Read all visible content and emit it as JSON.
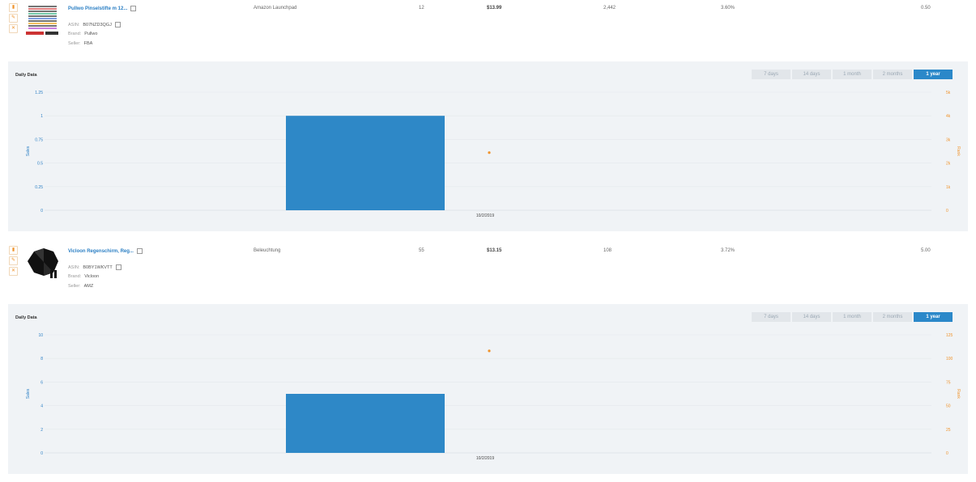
{
  "products": [
    {
      "title": "Pullwo Pinselstifte m 12...",
      "asin_label": "ASIN:",
      "asin": "B07NZD3QGJ",
      "brand_label": "Brand:",
      "brand": "Pullwo",
      "seller_label": "Seller:",
      "seller": "FBA",
      "category": "Amazon Launchpad",
      "col_a": "12",
      "price": "$13.99",
      "col_b": "2,442",
      "col_c": "3.60%",
      "col_d": "0.50",
      "chart": {
        "title": "Daily Data",
        "ranges": [
          "7 days",
          "14 days",
          "1 month",
          "2 months",
          "1 year"
        ],
        "active_range": "1 year",
        "left_axis_label": "Sales",
        "right_axis_label": "Rank",
        "left_ticks": [
          "1.25",
          "1",
          "0.75",
          "0.5",
          "0.25",
          "0"
        ],
        "right_ticks": [
          "5k",
          "4k",
          "3k",
          "2k",
          "1k",
          "0"
        ],
        "x_label": "10/2/2019"
      }
    },
    {
      "title": "Vicloon Regenschirm, Reg...",
      "asin_label": "ASIN:",
      "asin": "B0BY1WKVTT",
      "brand_label": "Brand:",
      "brand": "Vicloon",
      "seller_label": "Seller:",
      "seller": "AMZ",
      "category": "Beleuchtung",
      "col_a": "55",
      "price": "$13.15",
      "col_b": "108",
      "col_c": "3.72%",
      "col_d": "5.00",
      "chart": {
        "title": "Daily Data",
        "ranges": [
          "7 days",
          "14 days",
          "1 month",
          "2 months",
          "1 year"
        ],
        "active_range": "1 year",
        "left_axis_label": "Sales",
        "right_axis_label": "Rank",
        "left_ticks": [
          "10",
          "8",
          "6",
          "4",
          "2",
          "0"
        ],
        "right_ticks": [
          "125",
          "100",
          "75",
          "50",
          "25",
          "0"
        ],
        "x_label": "10/2/2019"
      }
    }
  ],
  "icons": {
    "chart": "bar-chart-icon",
    "edit": "edit-icon",
    "remove": "close-icon",
    "copy": "copy-icon"
  },
  "colors": {
    "sales_bar": "#2e88c7",
    "rank_point": "#f0932b",
    "accent": "#2b7fc4",
    "panel_bg": "#f0f3f6"
  },
  "chart_data": [
    {
      "type": "bar",
      "title": "",
      "x": [
        "10/2/2019"
      ],
      "ylabel": "Sales",
      "y2label": "Rank",
      "ylim": [
        0,
        1.25
      ],
      "y2lim": [
        0,
        5000
      ],
      "series": [
        {
          "name": "Sales",
          "axis": "left",
          "type": "bar",
          "values": [
            1
          ]
        },
        {
          "name": "Rank",
          "axis": "right",
          "type": "scatter",
          "values": [
            2442
          ]
        }
      ],
      "grid": true
    },
    {
      "type": "bar",
      "title": "",
      "x": [
        "10/2/2019"
      ],
      "ylabel": "Sales",
      "y2label": "Rank",
      "ylim": [
        0,
        10
      ],
      "y2lim": [
        0,
        125
      ],
      "series": [
        {
          "name": "Sales",
          "axis": "left",
          "type": "bar",
          "values": [
            5
          ]
        },
        {
          "name": "Rank",
          "axis": "right",
          "type": "scatter",
          "values": [
            108
          ]
        }
      ],
      "grid": true
    }
  ]
}
